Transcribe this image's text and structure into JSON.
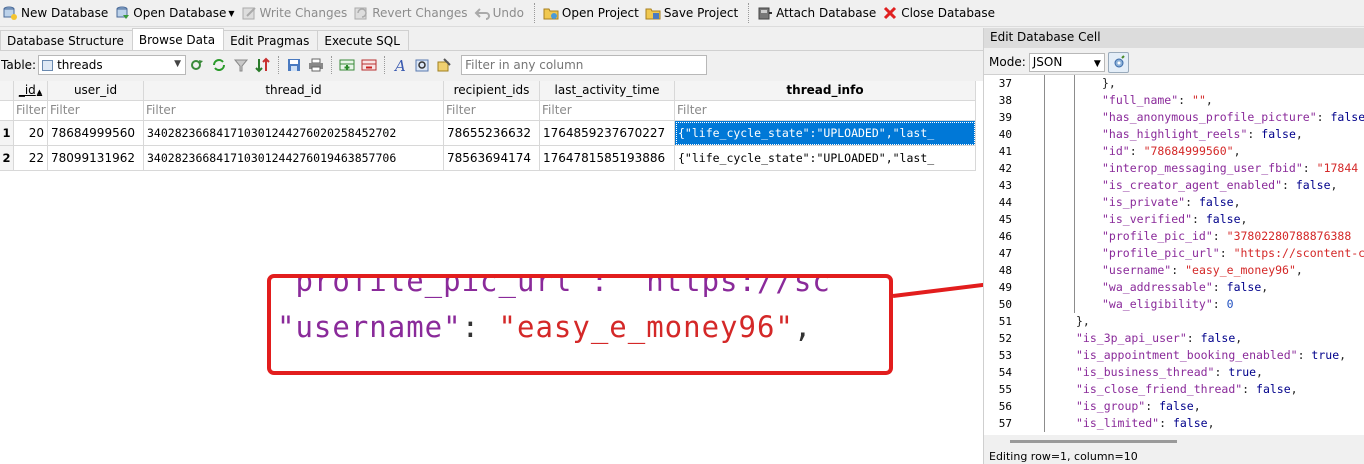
{
  "toolbar": {
    "items": [
      {
        "label": "New Database",
        "icon": "new-database-icon",
        "enabled": true
      },
      {
        "label": "Open Database",
        "icon": "open-database-icon",
        "enabled": true,
        "dropdown": true
      },
      {
        "label": "Write Changes",
        "icon": "write-changes-icon",
        "enabled": false
      },
      {
        "label": "Revert Changes",
        "icon": "revert-changes-icon",
        "enabled": false
      },
      {
        "label": "Undo",
        "icon": "undo-icon",
        "enabled": false
      },
      {
        "label": "Open Project",
        "icon": "open-project-icon",
        "enabled": true
      },
      {
        "label": "Save Project",
        "icon": "save-project-icon",
        "enabled": true
      },
      {
        "label": "Attach Database",
        "icon": "attach-database-icon",
        "enabled": true
      },
      {
        "label": "Close Database",
        "icon": "close-database-icon",
        "enabled": true
      }
    ]
  },
  "tabs": [
    "Database Structure",
    "Browse Data",
    "Edit Pragmas",
    "Execute SQL"
  ],
  "active_tab": "Browse Data",
  "table_bar": {
    "label": "Table:",
    "selected_table": "threads",
    "filter_placeholder": "Filter in any column"
  },
  "grid": {
    "columns": [
      "_id",
      "user_id",
      "thread_id",
      "recipient_ids",
      "last_activity_time",
      "thread_info"
    ],
    "sort_indicator": "▲",
    "filter_placeholder": "Filter",
    "rows": [
      {
        "rowno": "1",
        "cells": [
          "20",
          "78684999560",
          "340282366841710301244276020258452702",
          "78655236632",
          "1764859237670227",
          "{\"life_cycle_state\":\"UPLOADED\",\"last_"
        ]
      },
      {
        "rowno": "2",
        "cells": [
          "22",
          "78099131962",
          "340282366841710301244276019463857706",
          "78563694174",
          "1764781585193886",
          "{\"life_cycle_state\":\"UPLOADED\",\"last_"
        ]
      }
    ]
  },
  "callout": {
    "line_top": "\"profile_pic_url\": \"https://sc",
    "line_key": "\"username\"",
    "line_colon": ": ",
    "line_value": "\"easy_e_money96\"",
    "line_comma": ","
  },
  "editor_panel": {
    "title": "Edit Database Cell",
    "mode_label": "Mode:",
    "mode_value": "JSON",
    "status": "Editing row=1, column=10",
    "lines": [
      {
        "n": "37",
        "indent": 3,
        "text": "},",
        "type": "plain"
      },
      {
        "n": "38",
        "indent": 3,
        "key": "\"full_name\"",
        "value": "\"\"",
        "vtype": "s",
        "comma": true
      },
      {
        "n": "39",
        "indent": 3,
        "key": "\"has_anonymous_profile_picture\"",
        "value": "false",
        "vtype": "kw",
        "comma": false
      },
      {
        "n": "40",
        "indent": 3,
        "key": "\"has_highlight_reels\"",
        "value": "false",
        "vtype": "kw",
        "comma": true
      },
      {
        "n": "41",
        "indent": 3,
        "key": "\"id\"",
        "value": "\"78684999560\"",
        "vtype": "s",
        "comma": true
      },
      {
        "n": "42",
        "indent": 3,
        "key": "\"interop_messaging_user_fbid\"",
        "value": "\"17844",
        "vtype": "s",
        "comma": false
      },
      {
        "n": "43",
        "indent": 3,
        "key": "\"is_creator_agent_enabled\"",
        "value": "false",
        "vtype": "kw",
        "comma": true
      },
      {
        "n": "44",
        "indent": 3,
        "key": "\"is_private\"",
        "value": "false",
        "vtype": "kw",
        "comma": true
      },
      {
        "n": "45",
        "indent": 3,
        "key": "\"is_verified\"",
        "value": "false",
        "vtype": "kw",
        "comma": true
      },
      {
        "n": "46",
        "indent": 3,
        "key": "\"profile_pic_id\"",
        "value": "\"37802280788876388",
        "vtype": "s",
        "comma": false
      },
      {
        "n": "47",
        "indent": 3,
        "key": "\"profile_pic_url\"",
        "value": "\"https://scontent-c",
        "vtype": "s",
        "comma": false
      },
      {
        "n": "48",
        "indent": 3,
        "key": "\"username\"",
        "value": "\"easy_e_money96\"",
        "vtype": "s",
        "comma": true
      },
      {
        "n": "49",
        "indent": 3,
        "key": "\"wa_addressable\"",
        "value": "false",
        "vtype": "kw",
        "comma": true
      },
      {
        "n": "50",
        "indent": 3,
        "key": "\"wa_eligibility\"",
        "value": "0",
        "vtype": "n",
        "comma": false
      },
      {
        "n": "51",
        "indent": 2,
        "text": "},",
        "type": "plain"
      },
      {
        "n": "52",
        "indent": 2,
        "key": "\"is_3p_api_user\"",
        "value": "false",
        "vtype": "kw",
        "comma": true
      },
      {
        "n": "53",
        "indent": 2,
        "key": "\"is_appointment_booking_enabled\"",
        "value": "true",
        "vtype": "kw",
        "comma": true
      },
      {
        "n": "54",
        "indent": 2,
        "key": "\"is_business_thread\"",
        "value": "true",
        "vtype": "kw",
        "comma": true
      },
      {
        "n": "55",
        "indent": 2,
        "key": "\"is_close_friend_thread\"",
        "value": "false",
        "vtype": "kw",
        "comma": true
      },
      {
        "n": "56",
        "indent": 2,
        "key": "\"is_group\"",
        "value": "false",
        "vtype": "kw",
        "comma": true
      },
      {
        "n": "57",
        "indent": 2,
        "key": "\"is_limited\"",
        "value": "false",
        "vtype": "kw",
        "comma": true
      }
    ]
  },
  "colors": {
    "selection": "#0078d7",
    "callout_border": "#e21d1d",
    "json_key": "#8a2a9a",
    "json_string": "#d42828",
    "json_keyword": "#00008b",
    "json_number": "#2050c0"
  }
}
